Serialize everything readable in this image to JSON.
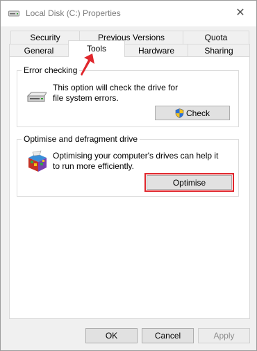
{
  "window": {
    "title": "Local Disk (C:) Properties",
    "close_glyph": "✕"
  },
  "tabs": {
    "row1": [
      "Security",
      "Previous Versions",
      "Quota"
    ],
    "row2": [
      "General",
      "Tools",
      "Hardware",
      "Sharing"
    ],
    "active": "Tools"
  },
  "error_checking": {
    "title": "Error checking",
    "description": "This option will check the drive for file system errors.",
    "button": "Check",
    "icon": "drive-icon",
    "button_icon": "uac-shield-icon"
  },
  "optimise": {
    "title": "Optimise and defragment drive",
    "description": "Optimising your computer's drives can help it to run more efficiently.",
    "button": "Optimise",
    "icon": "defrag-icon"
  },
  "footer": {
    "ok": "OK",
    "cancel": "Cancel",
    "apply": "Apply",
    "apply_enabled": false
  },
  "colors": {
    "highlight": "#e0262c",
    "accent": "#0078d7"
  }
}
